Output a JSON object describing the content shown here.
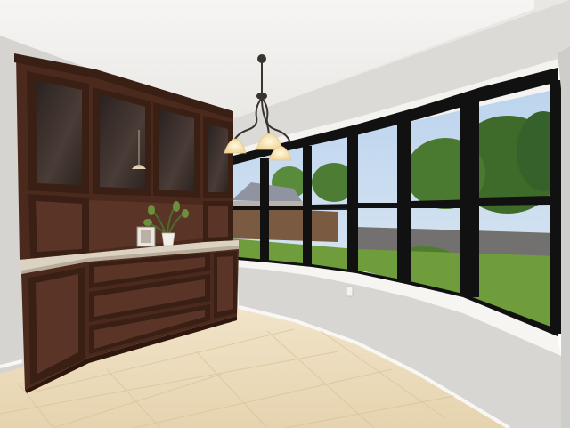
{
  "colors": {
    "ceiling": "#f3f2f0",
    "wall": "#dcdad6",
    "wall_shadow": "#c9c7c3",
    "sill": "#f6f5f2",
    "floor": "#ecdcbc",
    "floor_grout": "#d9c6a0",
    "baseboard": "#f7f6f3",
    "cabinet": "#4b2a1d",
    "cabinet_dark": "#2f170e",
    "cabinet_panel": "#5a3426",
    "countertop": "#d9cfbf",
    "glass": "#3a2e2a",
    "window_frame": "#111111",
    "sky": "#c9dcef",
    "grass": "#6f9d3c",
    "trees": "#3f6b2a",
    "fence": "#7a5a40",
    "chandelier_metal": "#3a3430",
    "lamp_glow": "#fff3cf"
  },
  "icons": [
    "chandelier-icon",
    "plant-icon",
    "picture-frame-icon",
    "outlet-icon"
  ]
}
